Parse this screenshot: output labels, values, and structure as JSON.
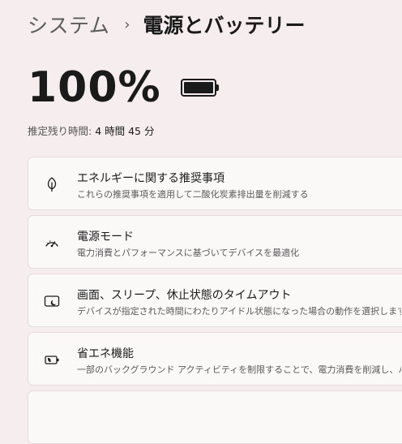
{
  "breadcrumb": {
    "parent": "システム",
    "separator": "›",
    "current": "電源とバッテリー"
  },
  "battery": {
    "percent_text": "100%",
    "level_percent": 100,
    "remaining_label": "推定残り時間:",
    "remaining_value": "4 時間 45 分"
  },
  "cards": [
    {
      "title": "エネルギーに関する推奨事項",
      "description": "これらの推奨事項を適用して二酸化炭素排出量を削減する",
      "icon": "leaf-icon"
    },
    {
      "title": "電源モード",
      "description": "電力消費とパフォーマンスに基づいてデバイスを最適化",
      "icon": "gauge-icon"
    },
    {
      "title": "画面、スリープ、休止状態のタイムアウト",
      "description": "デバイスが指定された時間にわたりアイドル状態になった場合の動作を選択します",
      "icon": "screen-sleep-icon"
    },
    {
      "title": "省エネ機能",
      "description": "一部のバックグラウンド アクティビティを制限することで、電力消費を削減し、バッテリーの",
      "icon": "battery-saver-icon"
    }
  ]
}
